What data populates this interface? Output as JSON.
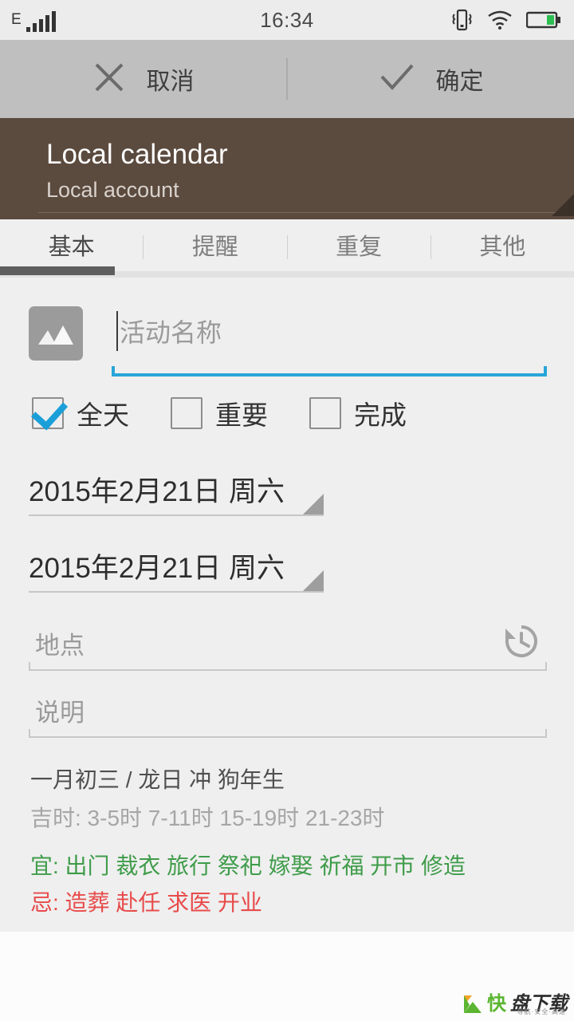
{
  "statusbar": {
    "network_type": "E",
    "time": "16:34",
    "icons": [
      "signal-bars-icon",
      "vibrate-icon",
      "wifi-icon",
      "battery-icon"
    ],
    "battery_color": "#2dbe52"
  },
  "actionbar": {
    "cancel_label": "取消",
    "cancel_icon": "close-icon",
    "confirm_label": "确定",
    "confirm_icon": "check-icon",
    "background": "#bfbfbf"
  },
  "account": {
    "title": "Local calendar",
    "subtitle": "Local account",
    "background": "#5b4a3e",
    "dropdown_icon": "corner-triangle-icon"
  },
  "tabs": {
    "items": [
      {
        "label": "基本",
        "active": true
      },
      {
        "label": "提醒",
        "active": false
      },
      {
        "label": "重复",
        "active": false
      },
      {
        "label": "其他",
        "active": false
      }
    ],
    "indicator_color": "#5e5e5e"
  },
  "form": {
    "image_icon": "image-placeholder-icon",
    "name_placeholder": "活动名称",
    "name_value": "",
    "focus_color": "#29a5d8",
    "checkboxes": [
      {
        "label": "全天",
        "checked": true
      },
      {
        "label": "重要",
        "checked": false
      },
      {
        "label": "完成",
        "checked": false
      }
    ],
    "start_date": "2015年2月21日 周六",
    "end_date": "2015年2月21日 周六",
    "location_placeholder": "地点",
    "location_value": "",
    "location_icon": "history-icon",
    "description_placeholder": "说明",
    "description_value": ""
  },
  "almanac": {
    "lunar": "一月初三 / 龙日 冲 狗年生",
    "auspicious_hours": "吉时: 3-5时 7-11时 15-19时 21-23时",
    "suitable": "宜: 出门 裁衣 旅行 祭祀 嫁娶 祈福 开市 修造",
    "avoid": "忌: 造葬 赴任 求医 开业",
    "suitable_color": "#3f9c4a",
    "avoid_color": "#e84b4b"
  },
  "watermark": {
    "brand_green": "快",
    "brand_dark": "盘下载",
    "tagline": "导航·安全·高速"
  }
}
